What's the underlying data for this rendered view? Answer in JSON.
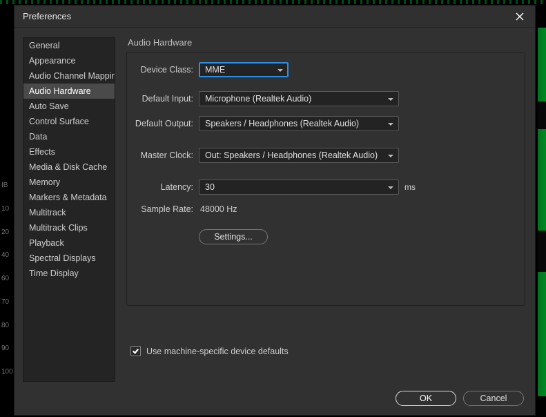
{
  "dialog": {
    "title": "Preferences"
  },
  "sidebar": {
    "items": [
      {
        "label": "General"
      },
      {
        "label": "Appearance"
      },
      {
        "label": "Audio Channel Mapping"
      },
      {
        "label": "Audio Hardware",
        "selected": true
      },
      {
        "label": "Auto Save"
      },
      {
        "label": "Control Surface"
      },
      {
        "label": "Data"
      },
      {
        "label": "Effects"
      },
      {
        "label": "Media & Disk Cache"
      },
      {
        "label": "Memory"
      },
      {
        "label": "Markers & Metadata"
      },
      {
        "label": "Multitrack"
      },
      {
        "label": "Multitrack Clips"
      },
      {
        "label": "Playback"
      },
      {
        "label": "Spectral Displays"
      },
      {
        "label": "Time Display"
      }
    ]
  },
  "panel": {
    "title": "Audio Hardware",
    "device_class_label": "Device Class:",
    "device_class_value": "MME",
    "default_input_label": "Default Input:",
    "default_input_value": "Microphone (Realtek Audio)",
    "default_output_label": "Default Output:",
    "default_output_value": "Speakers / Headphones (Realtek Audio)",
    "master_clock_label": "Master Clock:",
    "master_clock_value": "Out: Speakers / Headphones (Realtek Audio)",
    "latency_label": "Latency:",
    "latency_value": "30",
    "latency_unit": "ms",
    "sample_rate_label": "Sample Rate:",
    "sample_rate_value": "48000 Hz",
    "settings_button": "Settings...",
    "machine_defaults_label": "Use machine-specific device defaults",
    "machine_defaults_checked": true
  },
  "footer": {
    "ok": "OK",
    "cancel": "Cancel"
  },
  "bg_ruler": [
    "IB",
    "",
    "10",
    "20",
    "40",
    "60",
    "70",
    "80",
    "90",
    "100"
  ]
}
